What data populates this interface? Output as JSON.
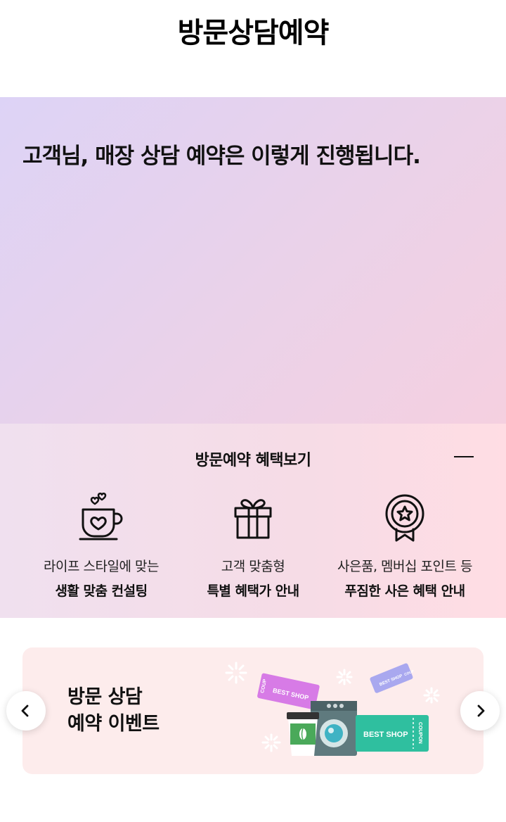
{
  "header": {
    "title": "방문상담예약"
  },
  "hero": {
    "headline": "고객님, 매장 상담 예약은 이렇게 진행됩니다."
  },
  "benefits": {
    "title": "방문예약 혜택보기",
    "items": [
      {
        "icon": "coffee-cup-heart-icon",
        "line1": "라이프 스타일에 맞는",
        "line2": "생활 맞춤 컨설팅"
      },
      {
        "icon": "gift-box-icon",
        "line1": "고객 맞춤형",
        "line2": "특별 혜택가 안내"
      },
      {
        "icon": "award-medal-icon",
        "line1": "사은품, 멤버십 포인트 등",
        "line2": "푸짐한 사은 혜택 안내"
      }
    ]
  },
  "event": {
    "line1": "방문 상담",
    "line2": "예약 이벤트",
    "coupon_labels": {
      "best_shop": "BEST SHOP",
      "coupon": "COUPON",
      "coup": "COUP"
    }
  },
  "colors": {
    "hero_gradient_start": "#ddd3f6",
    "hero_gradient_end": "#f5d0e0",
    "banner_bg": "#fdecec",
    "coupon_pink": "#d77be6",
    "coupon_teal": "#2fbf9f",
    "coupon_lavender": "#a9a8ef",
    "coffee_green": "#4aa95a",
    "washer_gray": "#5f7a7e"
  }
}
